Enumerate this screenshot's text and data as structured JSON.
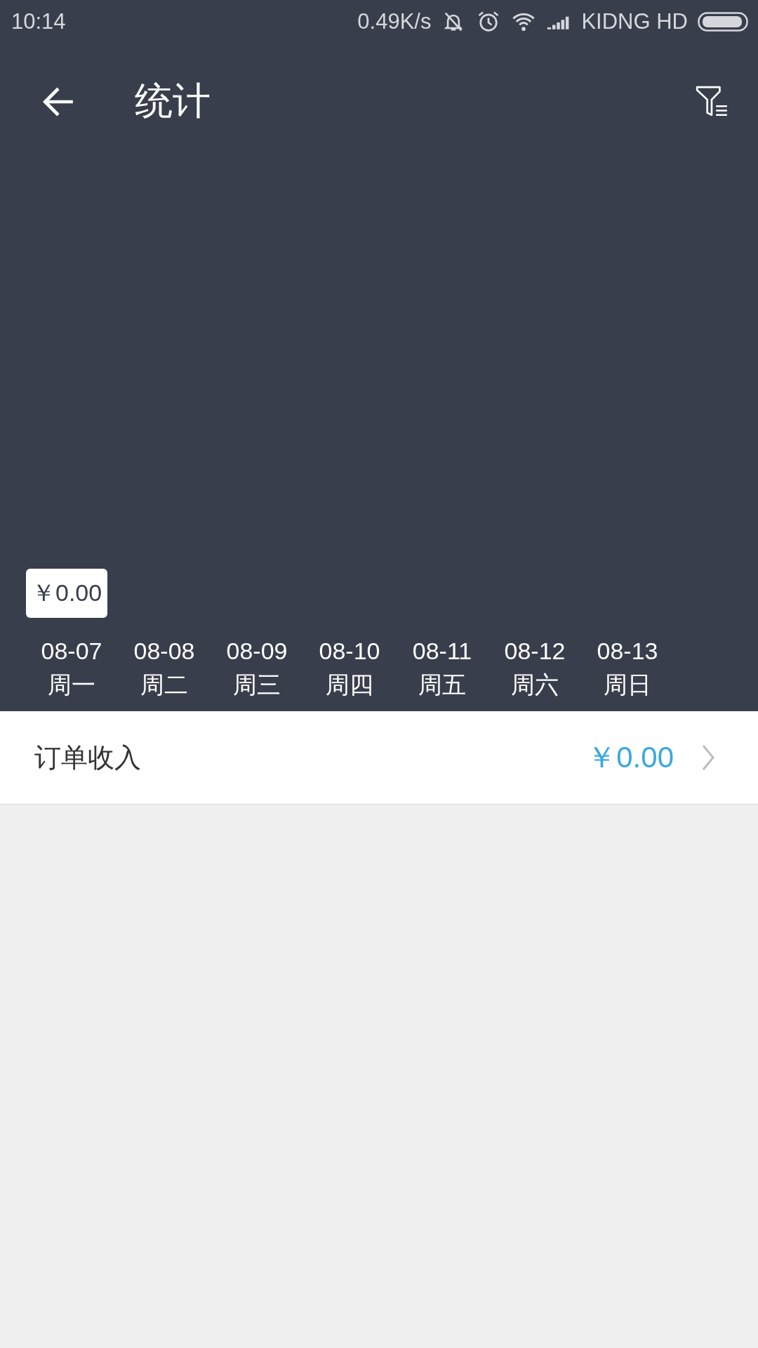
{
  "status_bar": {
    "time": "10:14",
    "speed": "0.49K/s",
    "carrier": "KIDNG HD"
  },
  "header": {
    "title": "统计"
  },
  "chart": {
    "tooltip": "￥0.00",
    "days": [
      {
        "date": "08-07",
        "weekday": "周一"
      },
      {
        "date": "08-08",
        "weekday": "周二"
      },
      {
        "date": "08-09",
        "weekday": "周三"
      },
      {
        "date": "08-10",
        "weekday": "周四"
      },
      {
        "date": "08-11",
        "weekday": "周五"
      },
      {
        "date": "08-12",
        "weekday": "周六"
      },
      {
        "date": "08-13",
        "weekday": "周日"
      }
    ]
  },
  "rows": [
    {
      "label": "订单收入",
      "value": "￥0.00"
    }
  ]
}
